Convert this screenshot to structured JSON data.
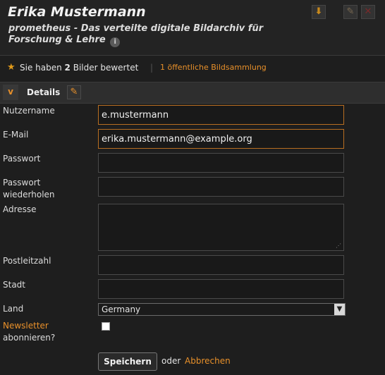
{
  "header": {
    "title": "Erika Mustermann",
    "subtitle": "prometheus - Das verteilte digitale Bildarchiv für Forschung & Lehre",
    "info_icon": "i"
  },
  "toolbar": {
    "download_icon": "⬇",
    "edit_icon": "✎",
    "delete_icon": "✕"
  },
  "stats": {
    "star_icon": "★",
    "rated_prefix": "Sie haben ",
    "rated_count": "2",
    "rated_suffix": " Bilder bewertet",
    "separator": "|",
    "public_collection_link": "1 öffentliche Bildsammlung"
  },
  "section": {
    "toggle_icon": "v",
    "title": "Details",
    "edit_icon": "✎"
  },
  "form": {
    "username_label": "Nutzername",
    "username_value": "e.mustermann",
    "email_label": "E-Mail",
    "email_value": "erika.mustermann@example.org",
    "password_label": "Passwort",
    "password_value": "",
    "password_repeat_label_1": "Passwort",
    "password_repeat_label_2": "wiederholen",
    "password_repeat_value": "",
    "address_label": "Adresse",
    "address_value": "",
    "zip_label": "Postleitzahl",
    "zip_value": "",
    "city_label": "Stadt",
    "city_value": "",
    "country_label": "Land",
    "country_value": "Germany",
    "newsletter_label_1": "Newsletter",
    "newsletter_label_2": "abonnieren?",
    "newsletter_checked": false,
    "save_label": "Speichern",
    "or_text": "oder",
    "cancel_label": "Abbrechen"
  },
  "colors": {
    "accent": "#e8902a",
    "background": "#1e1e1e",
    "header_bg": "#232323",
    "active_border": "#b86e22"
  }
}
